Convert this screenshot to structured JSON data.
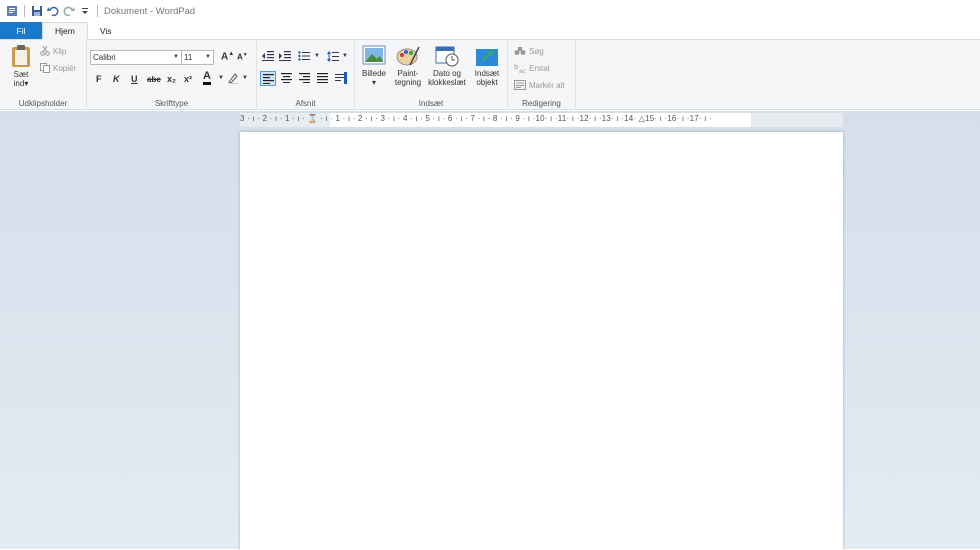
{
  "window": {
    "title": "Dokument - WordPad"
  },
  "quick_access": {
    "icons": [
      "wordpad-app-icon",
      "save-icon",
      "undo-icon",
      "redo-icon",
      "customize-icon"
    ]
  },
  "tabs": [
    {
      "label": "Fil"
    },
    {
      "label": "Hjem"
    },
    {
      "label": "Vis"
    }
  ],
  "clipboard": {
    "paste_label_1": "Sæt",
    "paste_label_2": "ind",
    "cut_label": "Klip",
    "copy_label": "Kopiér",
    "group_label": "Udklipsholder"
  },
  "font": {
    "family": "Calibri",
    "size": "11",
    "grow": "A",
    "shrink": "A",
    "bold": "F",
    "italic": "K",
    "underline": "U",
    "strike": "abc",
    "sub": "x₂",
    "sup": "x²",
    "color_a": "A",
    "group_label": "Skrifttype"
  },
  "paragraph": {
    "group_label": "Afsnit"
  },
  "insert": {
    "picture_label": "Billede",
    "paint_label_1": "Paint-",
    "paint_label_2": "tegning",
    "date_label_1": "Dato og",
    "date_label_2": "klokkeslæt",
    "object_label_1": "Indsæt",
    "object_label_2": "objekt",
    "group_label": "Indsæt"
  },
  "editing": {
    "find_label": "Søg",
    "replace_label": "Erstat",
    "select_all_label": "Markér alt",
    "group_label": "Redigering"
  },
  "ruler": {
    "marks": "3 · ı · 2 · ı · 1 · ı · ⌛ · ı · 1 · ı · 2 · ı · 3 · ı · 4 · ı · 5 · ı · 6 · ı · 7 · ı · 8 · ı · 9 · ı ·10· ı ·11· ı ·12· ı ·13· ı ·14· △15· ı ·16· ı ·17· ı ·"
  },
  "colors": {
    "file_tab": "#1979ca",
    "ribbon_bg": "#f5f6f7",
    "workspace_top": "#d5dfea",
    "workspace_bottom": "#e3ebf3"
  }
}
